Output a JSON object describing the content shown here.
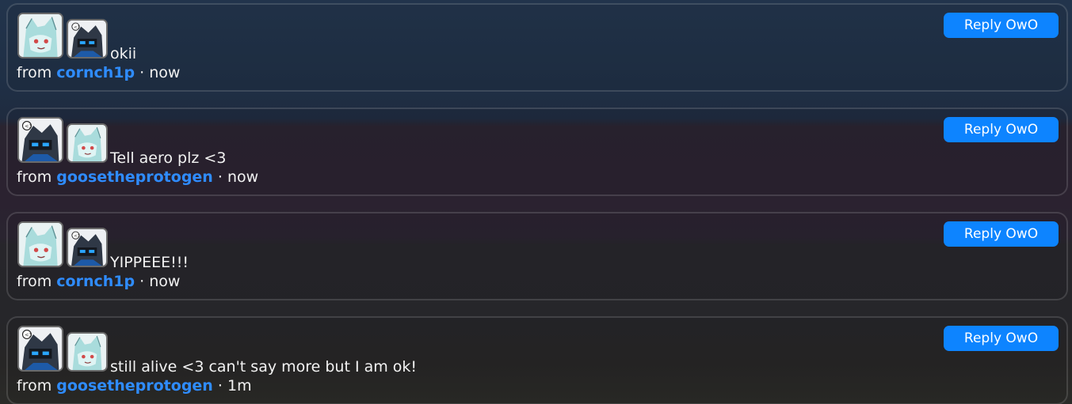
{
  "accent_color": "#0d84ff",
  "username_color": "#2f8cff",
  "messages": [
    {
      "text": "okii",
      "from_label": "from",
      "username": "cornch1p",
      "separator": "·",
      "time": "now",
      "reply_label": "Reply OwO",
      "avatar_big": "cornch1p-avatar",
      "avatar_small": "goosetheprotogen-avatar"
    },
    {
      "text": "Tell aero plz <3",
      "from_label": "from",
      "username": "goosetheprotogen",
      "separator": "·",
      "time": "now",
      "reply_label": "Reply OwO",
      "avatar_big": "goosetheprotogen-avatar",
      "avatar_small": "cornch1p-avatar"
    },
    {
      "text": "YIPPEEE!!!",
      "from_label": "from",
      "username": "cornch1p",
      "separator": "·",
      "time": "now",
      "reply_label": "Reply OwO",
      "avatar_big": "cornch1p-avatar",
      "avatar_small": "goosetheprotogen-avatar"
    },
    {
      "text": "still alive <3 can't say more but I am ok!",
      "from_label": "from",
      "username": "goosetheprotogen",
      "separator": "·",
      "time": "1m",
      "reply_label": "Reply OwO",
      "avatar_big": "goosetheprotogen-avatar",
      "avatar_small": "cornch1p-avatar"
    }
  ]
}
